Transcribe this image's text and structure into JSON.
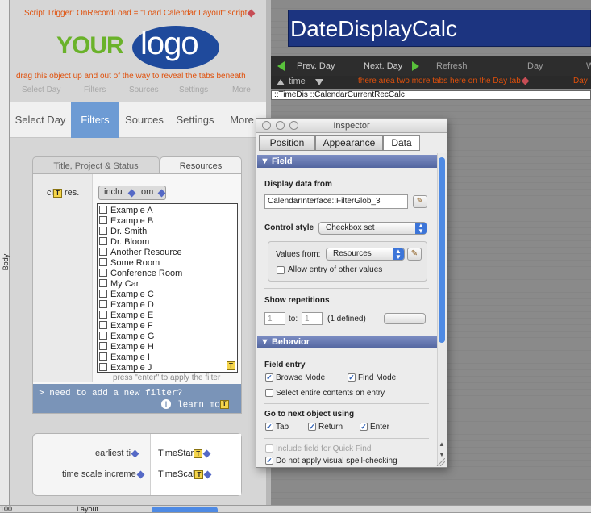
{
  "left_panel": {
    "script_trigger": "Script Trigger: OnRecordLoad = \"Load Calendar Layout\" script",
    "logo": {
      "part1": "YOUR",
      "part2": "logo"
    },
    "drag_note": "drag this object up and out of the way to reveal the tabs beneath",
    "ghost_tabs": [
      "Select Day",
      "Filters",
      "Sources",
      "Settings",
      "More"
    ],
    "tabs": [
      "Select Day",
      "Filters",
      "Sources",
      "Settings",
      "More"
    ],
    "active_tab": "Filters",
    "subtabs": [
      "Title, Project & Status",
      "Resources"
    ],
    "clear_label": "cl",
    "res_label": "res.",
    "include_label": "inclu",
    "omit_label": "om",
    "resources": [
      "Example A",
      "Example B",
      "Dr. Smith",
      "Dr. Bloom",
      "Another Resource",
      "Some Room",
      "Conference Room",
      "My Car",
      "Example C",
      "Example D",
      "Example E",
      "Example F",
      "Example G",
      "Example H",
      "Example I",
      "Example J"
    ],
    "apply_note": "press \"enter\" to apply the filter",
    "new_filter": "> need to add a new filter?",
    "learn_more": "learn mo",
    "earliest_label": "earliest ti",
    "timescale_label": "time scale increme",
    "timestart_field": "TimeStar",
    "timescale_field": "TimeScal",
    "body_label": "Body"
  },
  "right_area": {
    "title": "DateDisplayCalc",
    "nav": {
      "prev": "Prev. Day",
      "next": "Next. Day",
      "refresh": "Refresh",
      "day": "Day",
      "w": "W"
    },
    "time_label": "time",
    "tab_note": "there area two more tabs here on the Day tab",
    "day_note": "Day",
    "field_text": "::TimeDis        ::CalendarCurrentRecCalc"
  },
  "inspector": {
    "title": "Inspector",
    "tabs": [
      "Position",
      "Appearance",
      "Data"
    ],
    "active_tab": "Data",
    "field_section": "Field",
    "display_data_from_label": "Display data from",
    "display_data_from_value": "CalendarInterface::FilterGlob_3",
    "control_style_label": "Control style",
    "control_style_value": "Checkbox set",
    "values_from_label": "Values from:",
    "values_from_value": "Resources",
    "allow_other_label": "Allow entry of other values",
    "show_repetitions_label": "Show repetitions",
    "rep_from": "1",
    "rep_to_label": "to:",
    "rep_to": "1",
    "rep_defined": "(1 defined)",
    "behavior_section": "Behavior",
    "field_entry_label": "Field entry",
    "browse_mode": "Browse Mode",
    "find_mode": "Find Mode",
    "select_entire": "Select entire contents on entry",
    "go_next_label": "Go to next object using",
    "tab_key": "Tab",
    "return_key": "Return",
    "enter_key": "Enter",
    "quick_find": "Include field for Quick Find",
    "spell_check": "Do not apply visual spell-checking"
  },
  "statusbar": {
    "zoom": "100",
    "mode": "Layout"
  },
  "colors": {
    "accent_blue": "#6d9bd4",
    "title_bar": "#1c3480",
    "orange_note": "#e0500b",
    "logo_green": "#6ab22a",
    "logo_blue": "#1f4a9c"
  }
}
